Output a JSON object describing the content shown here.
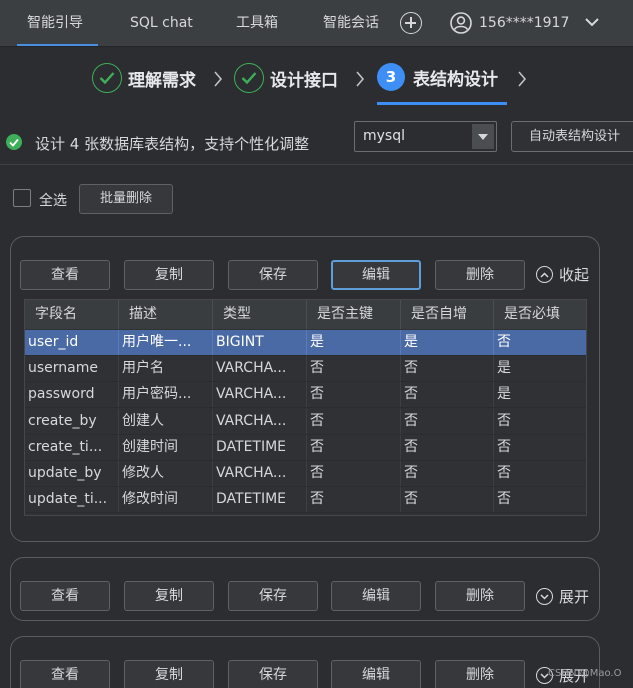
{
  "nav": {
    "items": [
      "智能引导",
      "SQL chat",
      "工具箱",
      "智能会话"
    ],
    "user_phone": "156****1917"
  },
  "steps": [
    {
      "label": "理解需求",
      "state": "done"
    },
    {
      "label": "设计接口",
      "state": "done"
    },
    {
      "number": "3",
      "label": "表结构设计",
      "state": "active"
    }
  ],
  "toolbar": {
    "status_text": "设计 4 张数据库表结构，支持个性化调整",
    "db_value": "mysql",
    "auto_button": "自动表结构设计"
  },
  "bulk": {
    "select_all": "全选",
    "batch_delete": "批量删除"
  },
  "panel_buttons": [
    "查看",
    "复制",
    "保存",
    "编辑",
    "删除"
  ],
  "panels": [
    {
      "toggle": "收起",
      "expanded": true
    },
    {
      "toggle": "展开",
      "expanded": false
    },
    {
      "toggle": "展开",
      "expanded": false
    }
  ],
  "table": {
    "columns": [
      "字段名",
      "描述",
      "类型",
      "是否主键",
      "是否自增",
      "是否必填"
    ],
    "rows": [
      [
        "user_id",
        "用户唯一...",
        "BIGINT",
        "是",
        "是",
        "否"
      ],
      [
        "username",
        "用户名",
        "VARCHA...",
        "否",
        "否",
        "是"
      ],
      [
        "password",
        "用户密码...",
        "VARCHA...",
        "否",
        "否",
        "是"
      ],
      [
        "create_by",
        "创建人",
        "VARCHA...",
        "否",
        "否",
        "否"
      ],
      [
        "create_ti...",
        "创建时间",
        "DATETIME",
        "否",
        "否",
        "否"
      ],
      [
        "update_by",
        "修改人",
        "VARCHA...",
        "否",
        "否",
        "否"
      ],
      [
        "update_ti...",
        "修改时间",
        "DATETIME",
        "否",
        "否",
        "否"
      ]
    ],
    "selected_row": 0
  },
  "watermark": "CSDN @Mao.O",
  "colors": {
    "accent": "#3d8ef5",
    "success": "#3fae5a",
    "selected_row": "#4a6aa5",
    "background": "#2b2d30"
  }
}
